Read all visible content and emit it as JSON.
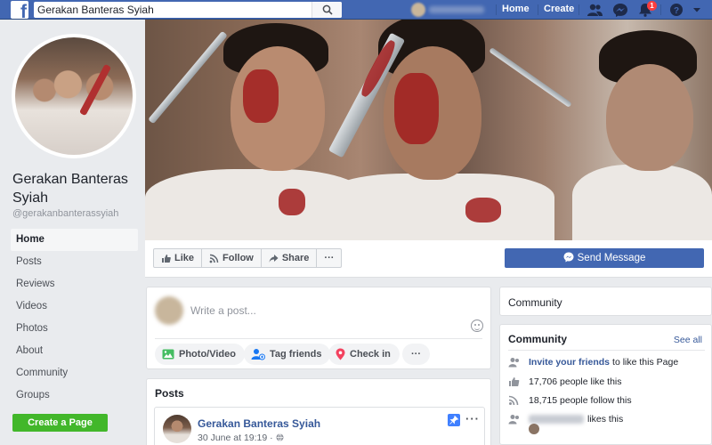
{
  "topbar": {
    "search_value": "Gerakan Banteras Syiah",
    "nav": {
      "home": "Home",
      "create": "Create"
    },
    "notification_count": "1",
    "icons": [
      "facebook-logo-icon",
      "search-icon",
      "friends-icon",
      "messenger-icon",
      "bell-icon",
      "help-icon",
      "caret-down-icon"
    ]
  },
  "page": {
    "name": "Gerakan Banteras Syiah",
    "handle": "@gerakanbanterassyiah"
  },
  "sidebar": {
    "items": [
      {
        "label": "Home",
        "active": true
      },
      {
        "label": "Posts"
      },
      {
        "label": "Reviews"
      },
      {
        "label": "Videos"
      },
      {
        "label": "Photos"
      },
      {
        "label": "About"
      },
      {
        "label": "Community"
      },
      {
        "label": "Groups"
      }
    ],
    "create_page": "Create a Page"
  },
  "actions": {
    "like": "Like",
    "follow": "Follow",
    "share": "Share",
    "more": "···",
    "send_message": "Send Message"
  },
  "composer": {
    "placeholder": "Write a post...",
    "photo_video": "Photo/Video",
    "tag_friends": "Tag friends",
    "check_in": "Check in",
    "more": "···"
  },
  "posts": {
    "title": "Posts",
    "items": [
      {
        "author": "Gerakan Banteras Syiah",
        "date": "30 June at 19:19 ·",
        "more": "···"
      }
    ]
  },
  "community_header": {
    "title": "Community"
  },
  "community": {
    "title": "Community",
    "see_all": "See all",
    "invite_link": "Invite your friends",
    "invite_rest": "to like this Page",
    "likes": "17,706 people like this",
    "follows": "18,715 people follow this",
    "friend_likes": "likes this"
  },
  "colors": {
    "brand": "#4267b2",
    "link": "#365899",
    "green": "#42b72a",
    "badge": "#fa3e3e"
  }
}
